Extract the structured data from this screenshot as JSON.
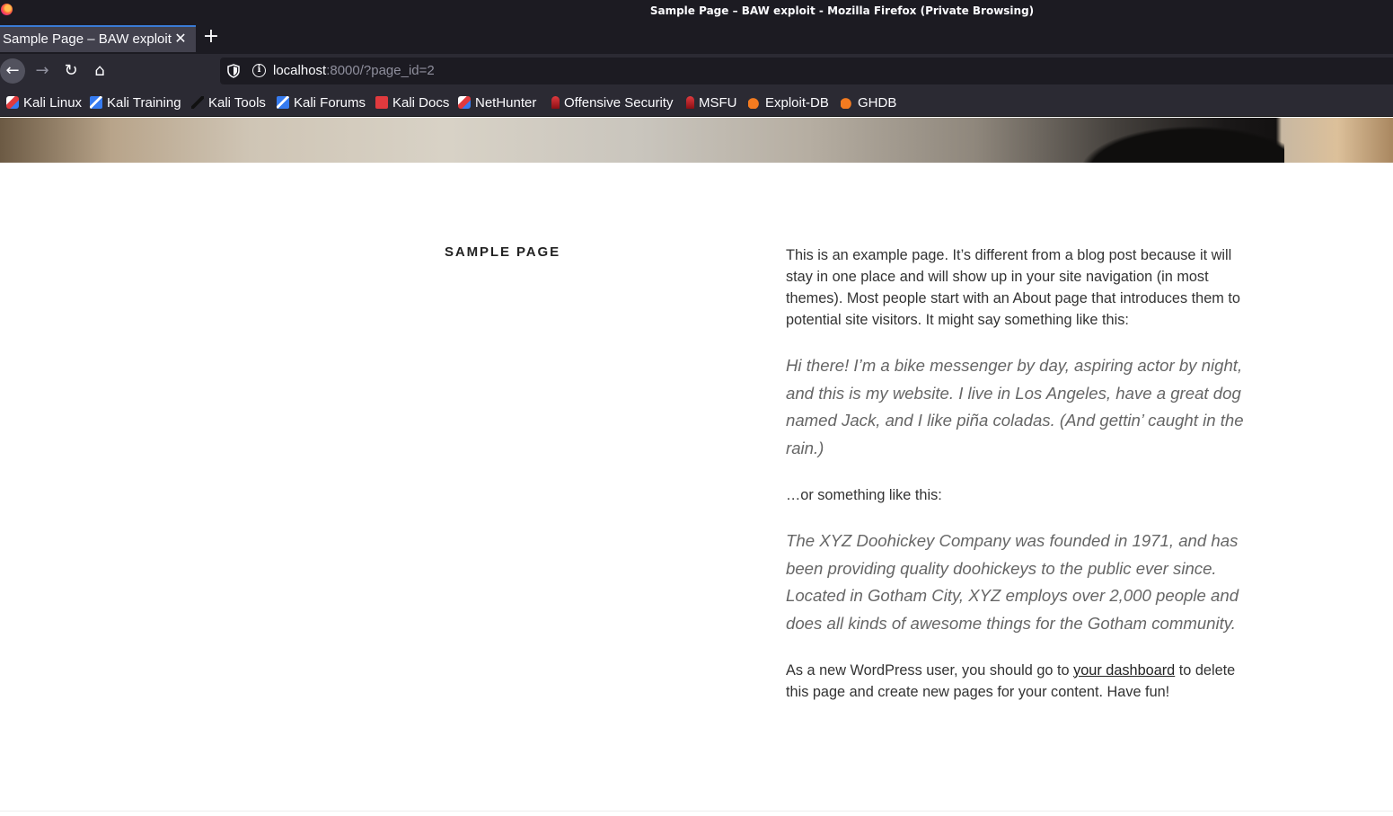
{
  "window": {
    "title": "Sample Page – BAW exploit - Mozilla Firefox (Private Browsing)"
  },
  "tabs": [
    {
      "label": "Sample Page – BAW exploit",
      "active": true,
      "close_glyph": "✕"
    }
  ],
  "newtab_glyph": "+",
  "nav": {
    "back_glyph": "←",
    "forward_glyph": "→",
    "reload_glyph": "↻",
    "home_glyph": "⌂"
  },
  "urlbar": {
    "host": "localhost",
    "rest": ":8000/?page_id=2",
    "info_glyph": "i"
  },
  "bookmarks": [
    {
      "label": "Kali Linux",
      "icon": "kali-icon"
    },
    {
      "label": "Kali Training",
      "icon": "kali-training-icon"
    },
    {
      "label": "Kali Tools",
      "icon": "kali-tools-icon"
    },
    {
      "label": "Kali Forums",
      "icon": "kali-forums-icon"
    },
    {
      "label": "Kali Docs",
      "icon": "kali-docs-icon"
    },
    {
      "label": "NetHunter",
      "icon": "nethunter-icon"
    },
    {
      "label": "Offensive Security",
      "icon": "offsec-icon"
    },
    {
      "label": "MSFU",
      "icon": "msfu-icon"
    },
    {
      "label": "Exploit-DB",
      "icon": "exploit-db-icon"
    },
    {
      "label": "GHDB",
      "icon": "ghdb-icon"
    }
  ],
  "page": {
    "title": "Sample Page",
    "intro": "This is an example page. It’s different from a blog post because it will stay in one place and will show up in your site navigation (in most themes). Most people start with an About page that introduces them to potential site visitors. It might say something like this:",
    "quote1": "Hi there! I’m a bike messenger by day, aspiring actor by night, and this is my website. I live in Los Angeles, have a great dog named Jack, and I like piña coladas. (And gettin’ caught in the rain.)",
    "or_text": "…or something like this:",
    "quote2": "The XYZ Doohickey Company was founded in 1971, and has been providing quality doohickeys to the public ever since. Located in Gotham City, XYZ employs over 2,000 people and does all kinds of awesome things for the Gotham community.",
    "outro_before": "As a new WordPress user, you should go to ",
    "outro_link": "your dashboard",
    "outro_after": " to delete this page and create new pages for your content. Have fun!"
  },
  "colors": {
    "chrome_dark": "#1c1b22",
    "toolbar": "#2b2a33",
    "tab_active": "#42414d",
    "text_light": "#fbfbfe",
    "body_text": "#333333",
    "quote_text": "#666666"
  }
}
